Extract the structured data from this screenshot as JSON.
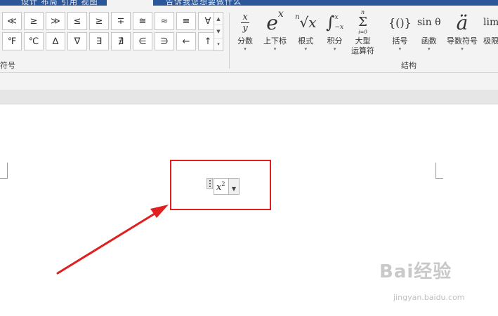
{
  "tabs": {
    "cut_text_1": "设计    布局    引用    视图",
    "cut_text_2": "告诉我您想要做什么"
  },
  "symbols": {
    "items": [
      "≪",
      "≥",
      "≫",
      "≤",
      "≥",
      "∓",
      "≅",
      "≈",
      "≡",
      "∀",
      "℉",
      "℃",
      "∆",
      "∇",
      "∃",
      "∄",
      "∈",
      "∋",
      "←",
      "↑"
    ],
    "group_label": "符号"
  },
  "structures": {
    "group_label": "结构",
    "buttons": [
      {
        "label": "分数",
        "icon": "fraction-icon"
      },
      {
        "label": "上下标",
        "icon": "script-icon"
      },
      {
        "label": "根式",
        "icon": "radical-icon"
      },
      {
        "label": "积分",
        "icon": "integral-icon"
      },
      {
        "label": "大型\n运算符",
        "icon": "large-operator-icon"
      },
      {
        "label": "括号",
        "icon": "bracket-icon"
      },
      {
        "label": "函数",
        "icon": "function-icon"
      },
      {
        "label": "导数符号",
        "icon": "accent-icon"
      },
      {
        "label": "极限",
        "icon": "limit-icon"
      }
    ],
    "fraction_top": "x",
    "fraction_bottom": "y",
    "script_base": "e",
    "script_sup": "x",
    "radical_index": "n",
    "radical_body": "√x",
    "integral_sign": "∫",
    "integral_upper": "x",
    "integral_lower": "−x",
    "sum_upper": "n",
    "sum_sign": "Σ",
    "sum_lower": "i=0",
    "bracket_text": "{()}",
    "function_text": "sin θ",
    "accent_text": "ä",
    "limit_text": "lim"
  },
  "document": {
    "equation_base": "x",
    "equation_sup": "2"
  },
  "watermark": {
    "logo_text": "Bai经验",
    "sub_text": "jingyan.baidu.com"
  },
  "colors": {
    "title_bar": "#2b579a",
    "ribbon_bg": "#f3f3f3",
    "highlight": "#e02020"
  }
}
